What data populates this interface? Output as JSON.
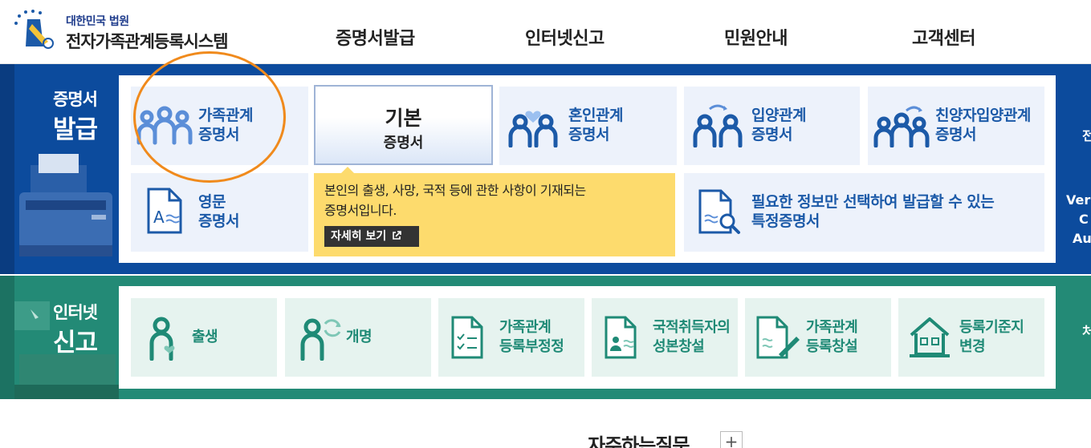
{
  "header": {
    "logo_small": "대한민국 법원",
    "logo_title": "전자가족관계등록시스템",
    "nav": [
      "증명서발급",
      "인터넷신고",
      "민원안내",
      "고객센터"
    ]
  },
  "certificate_section": {
    "label_small": "증명서",
    "label_big": "발급",
    "cards": {
      "family": [
        "가족관계",
        "증명서"
      ],
      "basic": [
        "기본",
        "증명서"
      ],
      "marriage": [
        "혼인관계",
        "증명서"
      ],
      "adoption": [
        "입양관계",
        "증명서"
      ],
      "full_adoption": [
        "친양자입양관계",
        "증명서"
      ],
      "english": [
        "영문",
        "증명서"
      ],
      "specific": [
        "필요한 정보만 선택하여 발급할 수 있는",
        "특정증명서"
      ]
    },
    "tooltip": {
      "line1": "본인의 출생, 사망, 국적 등에 관한 사항이 기재되는",
      "line2": "증명서입니다.",
      "more": "자세히 보기"
    },
    "right_edge": {
      "line1": "전",
      "line2": "Veri",
      "line3": "C",
      "line4": "Au"
    }
  },
  "report_section": {
    "label_small": "인터넷",
    "label_big": "신고",
    "cards": {
      "birth": [
        "출생"
      ],
      "rename": [
        "개명"
      ],
      "correction": [
        "가족관계",
        "등록부정정"
      ],
      "nationality": [
        "국적취득자의",
        "성본창설"
      ],
      "creation": [
        "가족관계",
        "등록창설"
      ],
      "domicile": [
        "등록기준지",
        "변경"
      ]
    },
    "right_edge": "처"
  },
  "faq": {
    "title": "자주하는질문",
    "plus": "+"
  },
  "colors": {
    "blue_band": "#0c4b9d",
    "green_band": "#238a76",
    "tooltip": "#fddb6d",
    "highlight": "#f08a1c"
  }
}
